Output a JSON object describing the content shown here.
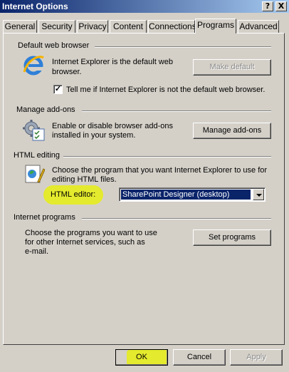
{
  "window": {
    "title": "Internet Options",
    "help_label": "?",
    "close_label": "X"
  },
  "tabs": [
    {
      "label": "General"
    },
    {
      "label": "Security"
    },
    {
      "label": "Privacy"
    },
    {
      "label": "Content"
    },
    {
      "label": "Connections"
    },
    {
      "label": "Programs",
      "active": true
    },
    {
      "label": "Advanced"
    }
  ],
  "default_browser": {
    "title": "Default web browser",
    "status_line1": "Internet Explorer is the default web",
    "status_line2": "browser.",
    "make_default_label": "Make default",
    "check_label": "Tell me if Internet Explorer is not the default web browser.",
    "check_mark": "✓"
  },
  "addons": {
    "title": "Manage add-ons",
    "desc_line1": "Enable or disable browser add-ons",
    "desc_line2": "installed in your system.",
    "button_label": "Manage add-ons"
  },
  "html_editing": {
    "title": "HTML editing",
    "desc_line1": "Choose the program that you want Internet Explorer to use for",
    "desc_line2": "editing HTML files.",
    "editor_label": "HTML editor:",
    "editor_value": "SharePoint Designer (desktop)"
  },
  "internet_programs": {
    "title": "Internet programs",
    "desc_line1": "Choose the programs you want to use",
    "desc_line2": "for other Internet services, such as",
    "desc_line3": "e-mail.",
    "button_label": "Set programs"
  },
  "footer": {
    "ok_label": "OK",
    "cancel_label": "Cancel",
    "apply_label": "Apply"
  },
  "colors": {
    "highlight": "#e6ec1c",
    "selection": "#0a246a",
    "face": "#d4d0c8"
  }
}
